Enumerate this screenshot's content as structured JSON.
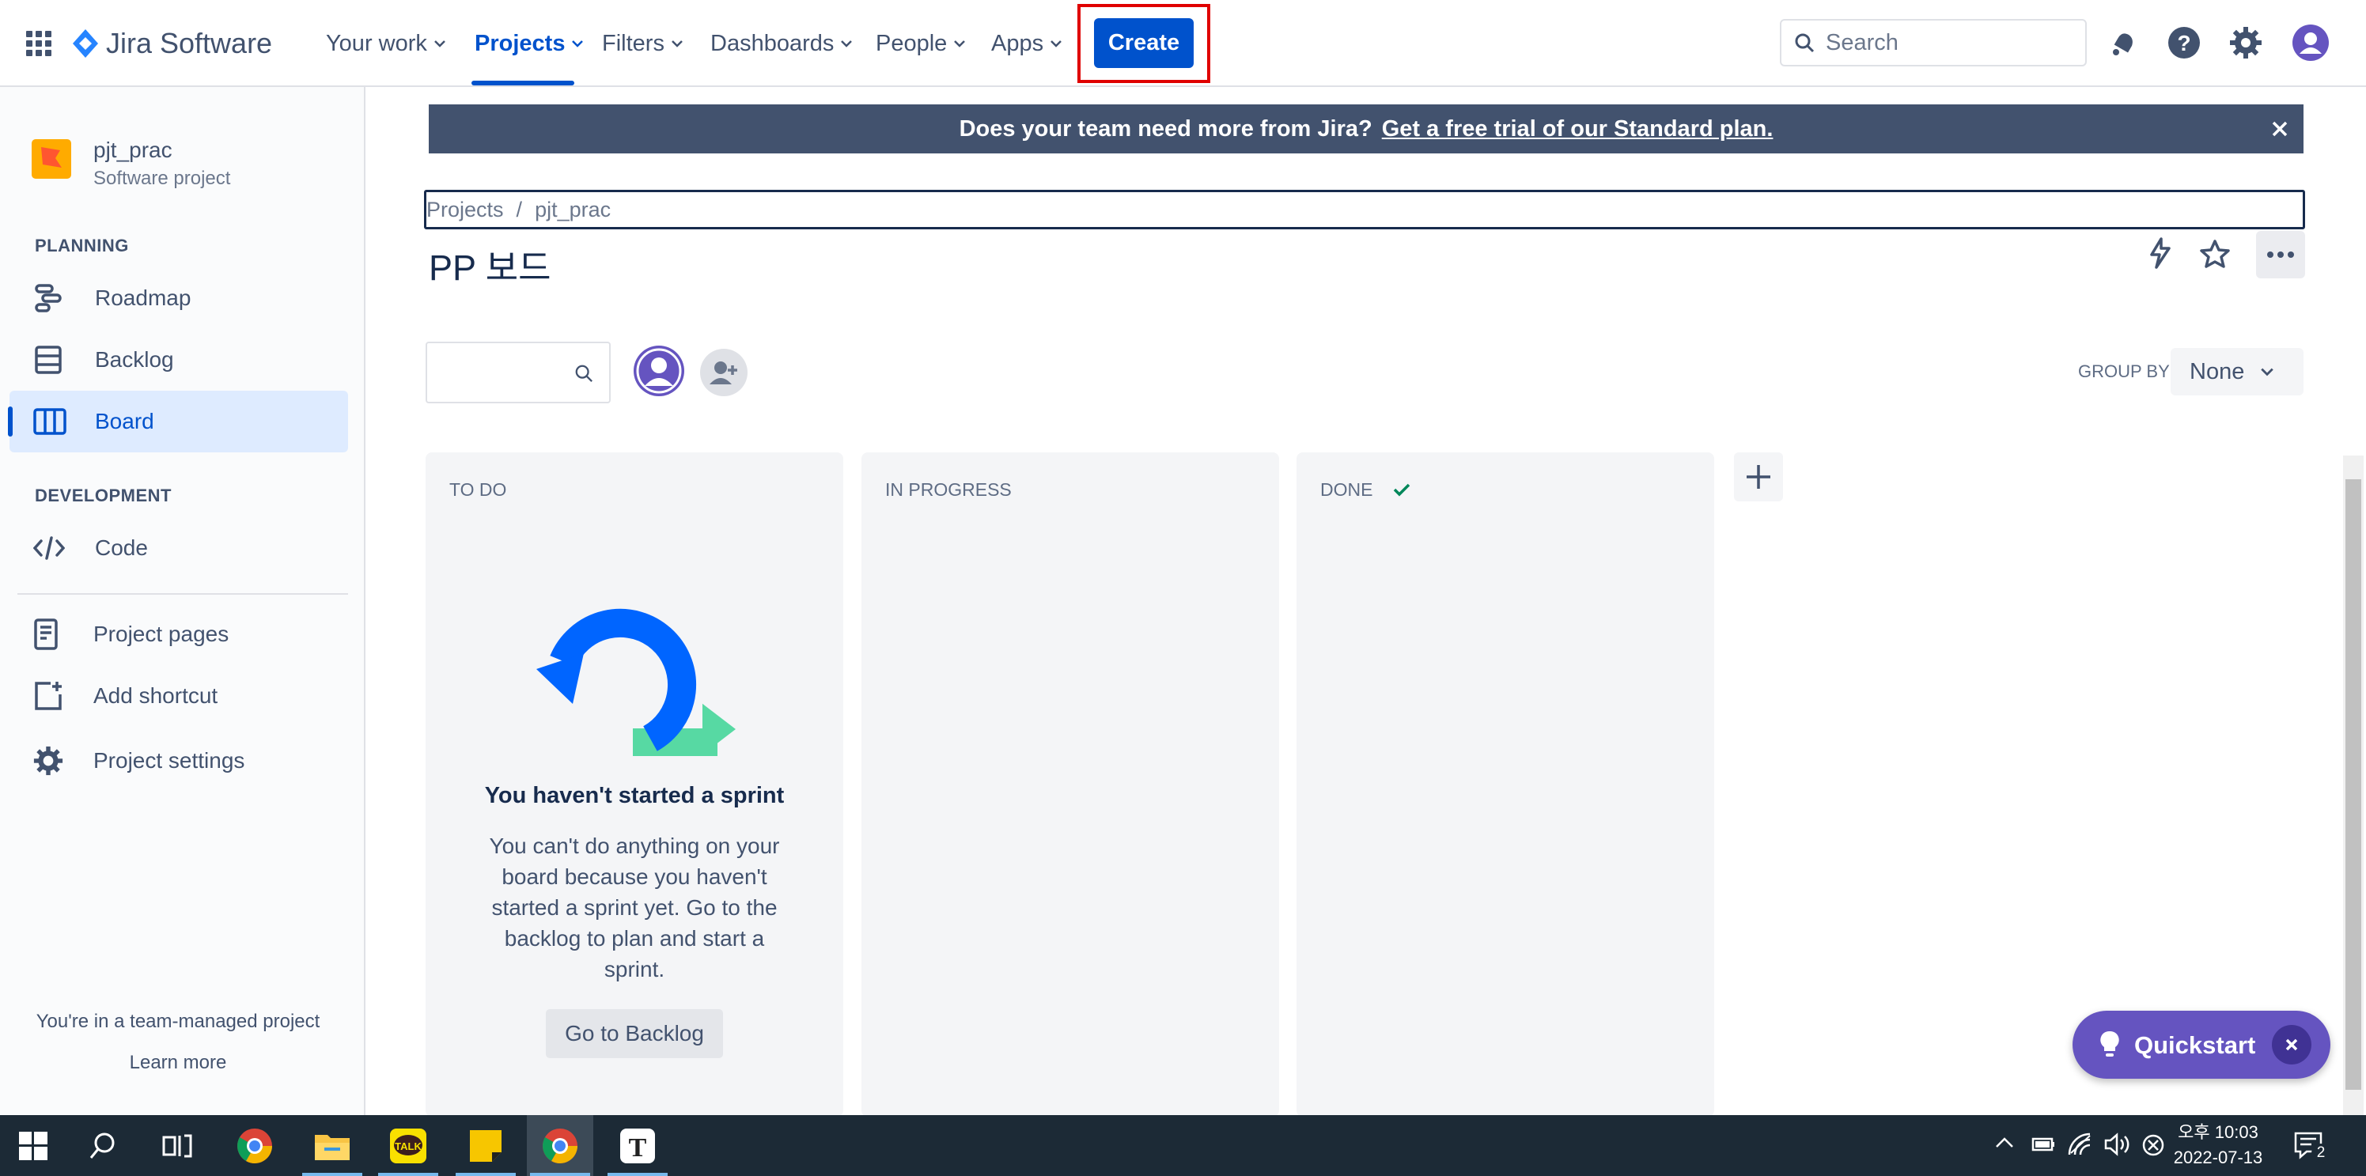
{
  "brand": {
    "product": "Jira Software"
  },
  "nav": {
    "your_work": "Your work",
    "projects": "Projects",
    "filters": "Filters",
    "dashboards": "Dashboards",
    "people": "People",
    "apps": "Apps",
    "create": "Create"
  },
  "search": {
    "placeholder": "Search"
  },
  "sidebar": {
    "project_name": "pjt_prac",
    "project_type": "Software project",
    "planning_heading": "PLANNING",
    "roadmap": "Roadmap",
    "backlog": "Backlog",
    "board": "Board",
    "development_heading": "DEVELOPMENT",
    "code": "Code",
    "project_pages": "Project pages",
    "add_shortcut": "Add shortcut",
    "project_settings": "Project settings",
    "footer_text": "You're in a team-managed project",
    "learn_more": "Learn more"
  },
  "banner": {
    "text": "Does your team need more from Jira?",
    "link": "Get a free trial of our Standard plan."
  },
  "breadcrumb": {
    "projects": "Projects",
    "separator": "/",
    "project": "pjt_prac"
  },
  "board": {
    "title": "PP 보드",
    "group_by_label": "GROUP BY",
    "group_by_value": "None",
    "columns": [
      "TO DO",
      "IN PROGRESS",
      "DONE"
    ],
    "empty_title": "You haven't started a sprint",
    "empty_lines": [
      "You can't do anything on your",
      "board because you haven't",
      "started a sprint yet. Go to the",
      "backlog to plan and start a",
      "sprint."
    ],
    "go_to_backlog": "Go to Backlog"
  },
  "quickstart": {
    "label": "Quickstart"
  },
  "taskbar": {
    "time_prefix": "오후",
    "time": "10:03",
    "date": "2022-07-13",
    "notification_count": "2"
  },
  "colors": {
    "primary": "#0052cc",
    "banner": "#42526e",
    "quickstart": "#6554c0",
    "highlight": "#e00000"
  }
}
